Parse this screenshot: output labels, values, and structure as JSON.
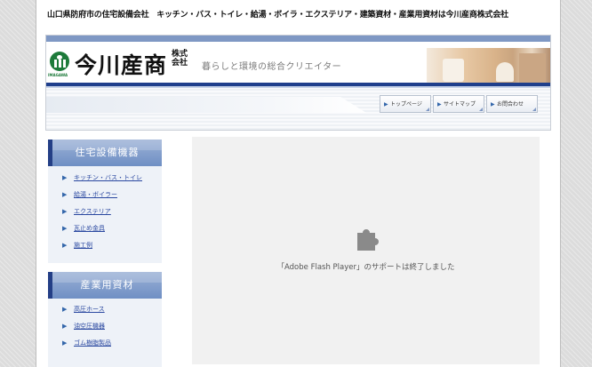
{
  "header": {
    "top_text": "山口県防府市の住宅設備会社　キッチン・バス・トイレ・給湯・ボイラ・エクステリア・建築資材・産業用資材は今川産商株式会社",
    "logo_name": "今川産商",
    "logo_kabu": "株式会社",
    "logo_sub": "IMAGAWA",
    "tagline": "暮らしと環境の総合クリエイター"
  },
  "nav": {
    "items": [
      {
        "label": "トップページ"
      },
      {
        "label": "サイトマップ"
      },
      {
        "label": "お問合わせ"
      }
    ]
  },
  "sidebar": {
    "sections": [
      {
        "title": "住宅設備機器",
        "items": [
          "キッチン・バス・トイレ",
          "給湯・ボイラー",
          "エクステリア",
          "瓦止め金具",
          "施工例"
        ]
      },
      {
        "title": "産業用資材",
        "items": [
          "高圧ホース",
          "油空圧機器",
          "ゴム樹脂製品"
        ]
      }
    ]
  },
  "flash": {
    "message": "「Adobe Flash Player」のサポートは終了しました",
    "icon": "puzzle-piece-icon"
  },
  "colors": {
    "brand_blue": "#1f3f8c",
    "accent_blue": "#7f98c4",
    "logo_green": "#1d7a3a",
    "link": "#2a48a0"
  }
}
